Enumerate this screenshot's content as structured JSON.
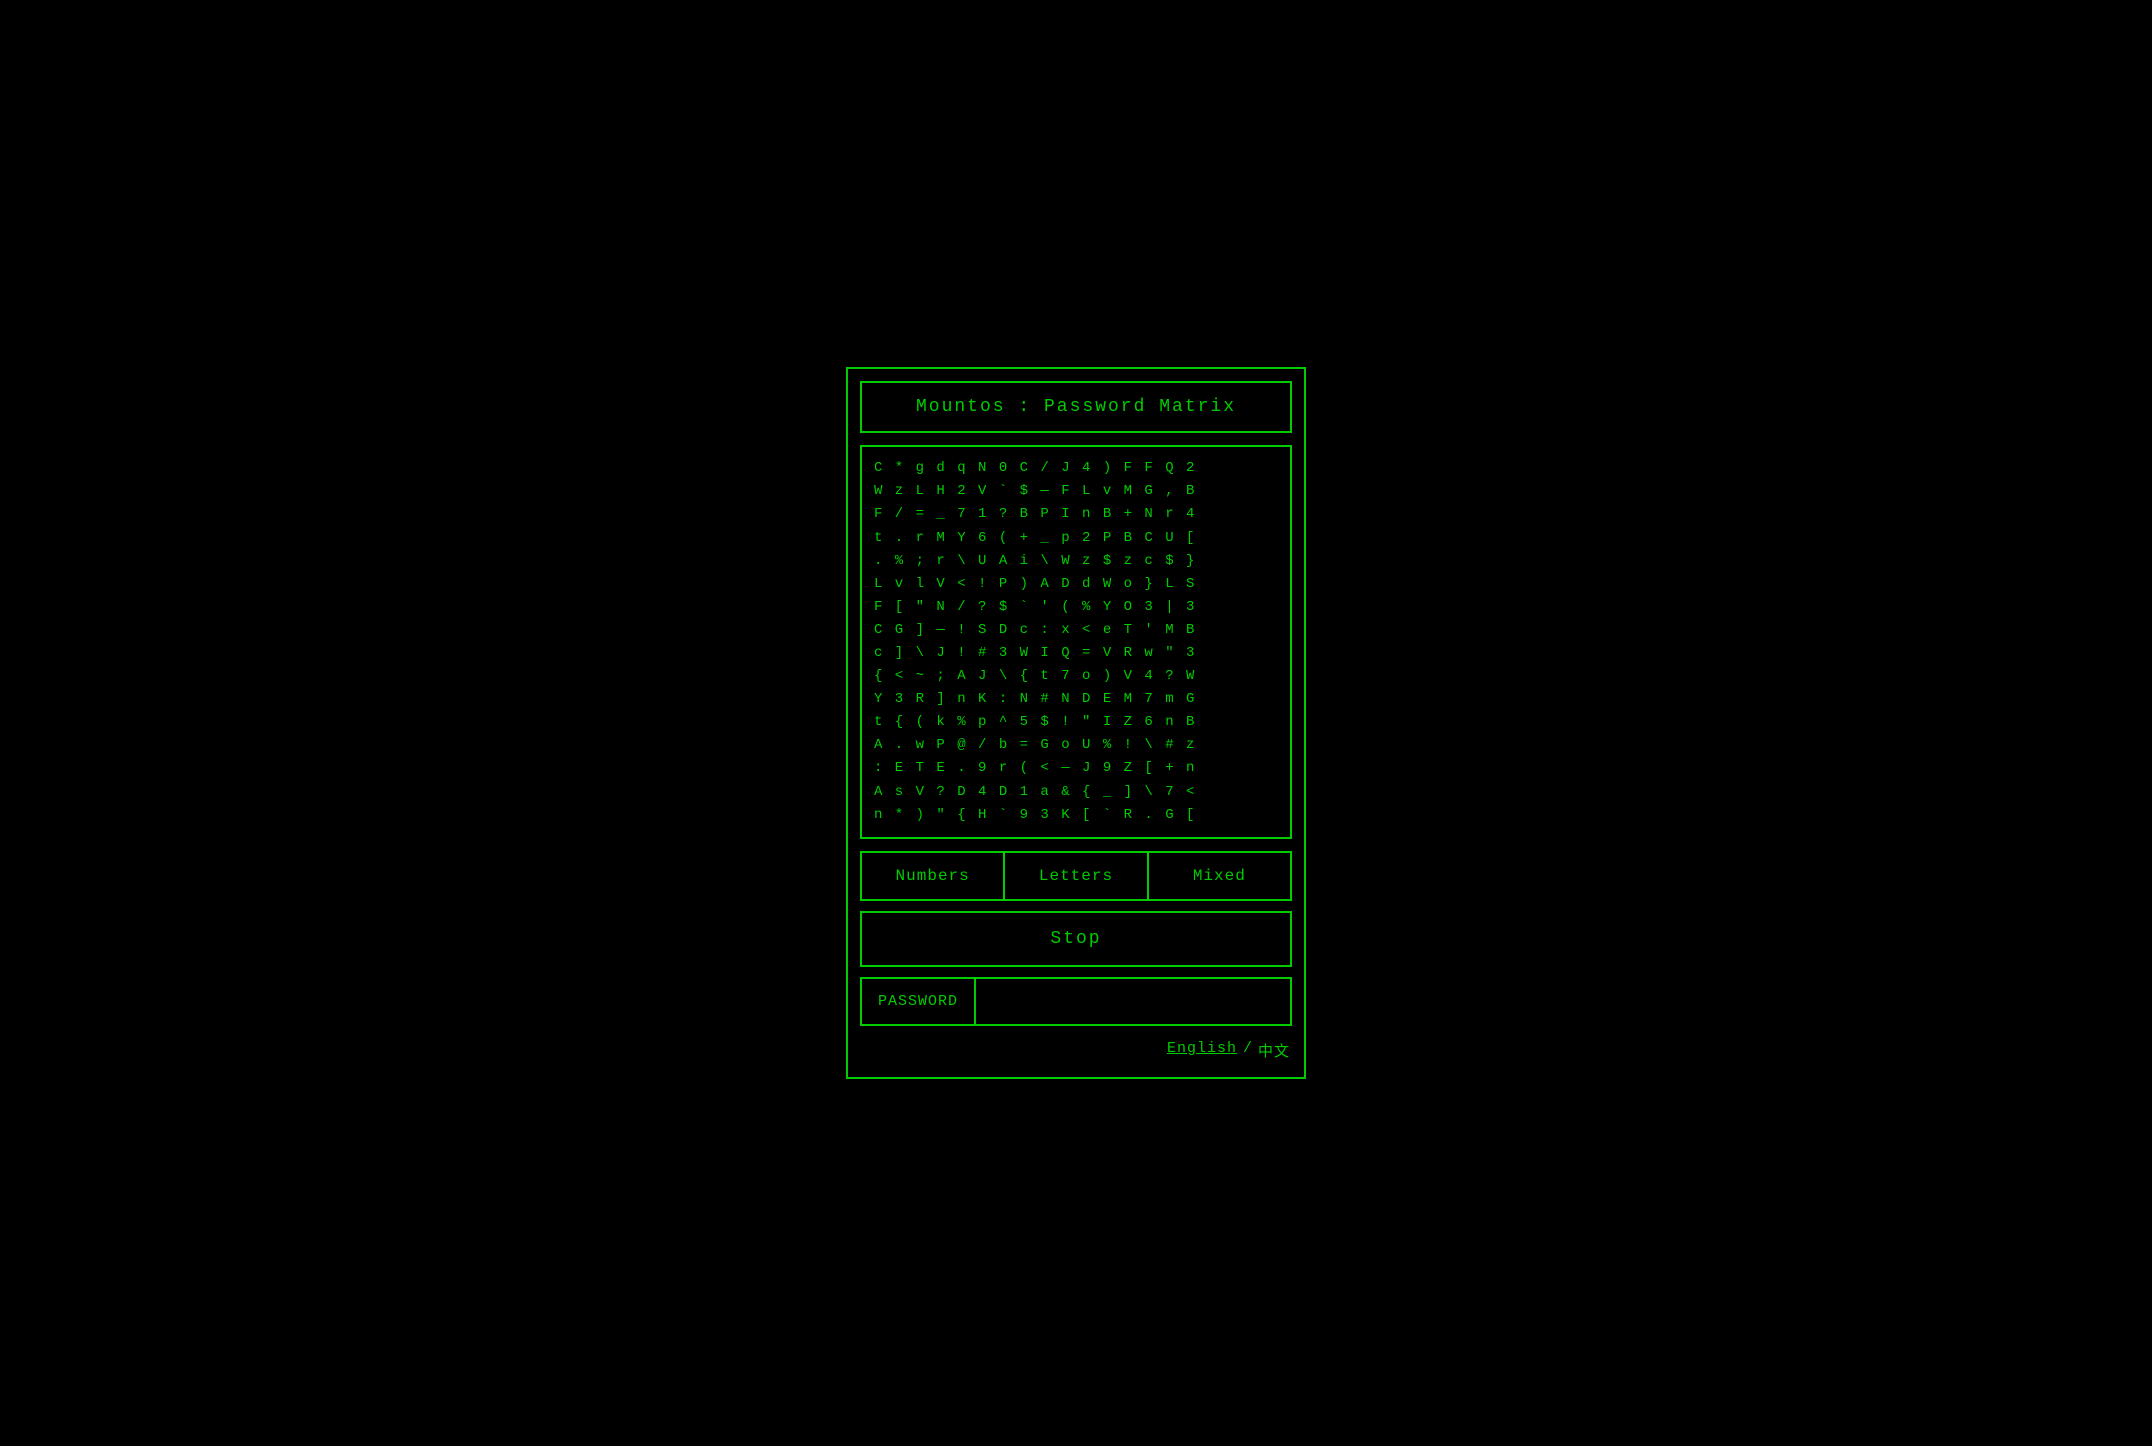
{
  "app": {
    "title": "Mountos : Password Matrix",
    "matrix_lines": [
      "C * g d q N 0 C / J 4 ) F F Q 2",
      "W z L H 2 V ` $ — F L v M G , B",
      "F / = _ 7 1 ? B P I n B + N r 4",
      "t . r M Y 6 ( + _ p 2 P B C U [",
      ". % ; r \\ U A i \\ W z $ z c $ }",
      "L v l V < ! P ) A D d W o } L S",
      "F [ \" N / ? $ ` ' ( % Y O 3 | 3",
      "C G ] — ! S D c : x < e T ' M B",
      "c ] \\ J ! # 3 W I Q = V R w \" 3",
      "{ < ~ ; A J \\ { t 7 o ) V 4 ? W",
      "Y 3 R ] n K : N # N D E M 7 m G",
      "t { ( k % p ^ 5 $ ! \" I Z 6 n B",
      "A . w P @ / b = G o U % ! \\ # z",
      ": E T E . 9 r ( < — J 9 Z [ + n",
      "A s V ? D 4 D 1 a & { _ ] \\ 7 <",
      "n * ) \" { H ` 9 3 K [ ` R . G ["
    ]
  },
  "buttons": {
    "numbers": "Numbers",
    "letters": "Letters",
    "mixed": "Mixed",
    "stop": "Stop"
  },
  "password": {
    "label": "PASSWORD",
    "placeholder": ""
  },
  "language": {
    "english": "English",
    "separator": "/",
    "chinese": "中文"
  }
}
